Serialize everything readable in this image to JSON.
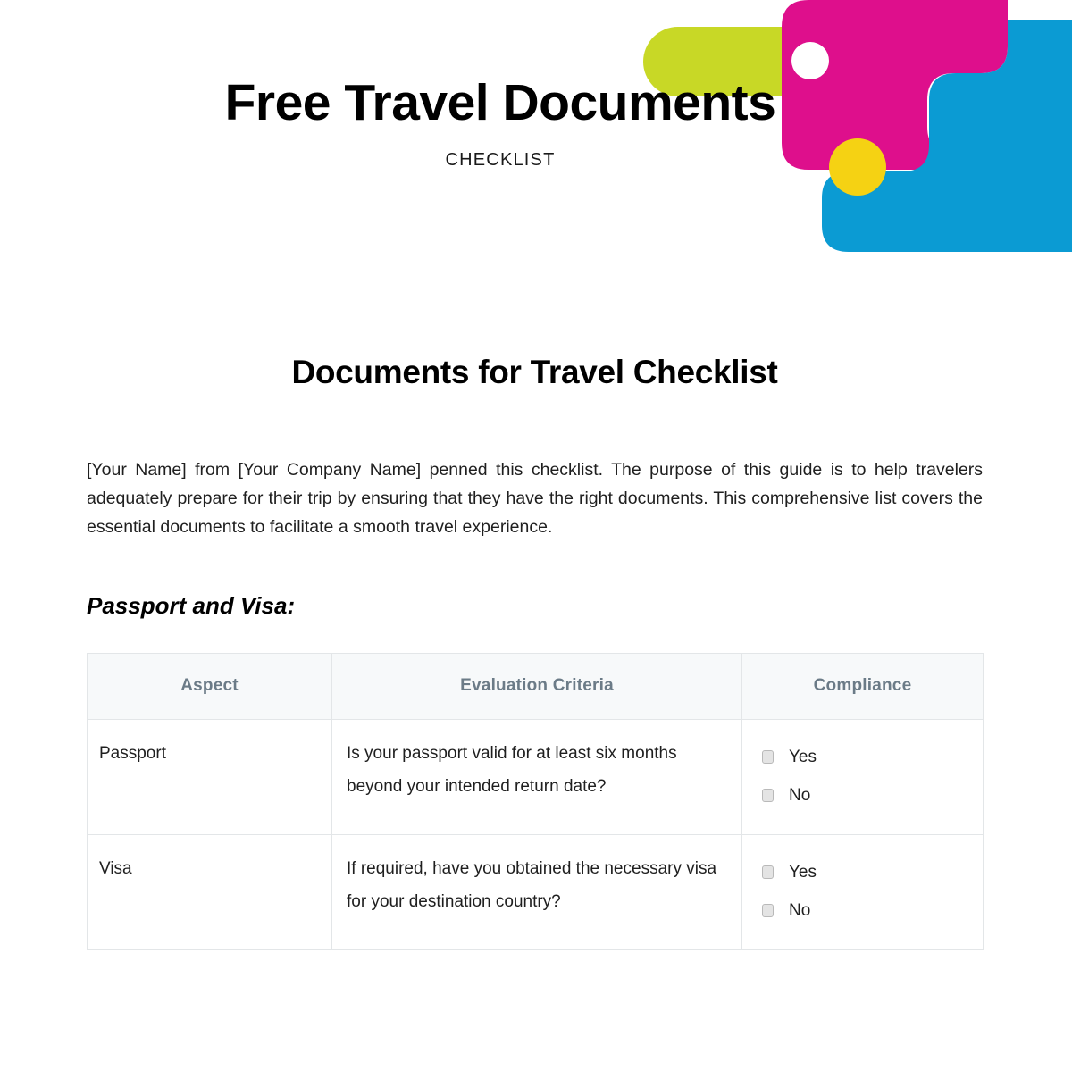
{
  "header": {
    "title": "Free Travel Documents",
    "subtitle": "CHECKLIST"
  },
  "decor": {
    "lime": "#c8d826",
    "magenta": "#de0f8c",
    "cyan": "#0b9bd3",
    "yellow": "#f5d213",
    "white": "#ffffff"
  },
  "main": {
    "section_title": "Documents for Travel Checklist",
    "intro": "[Your Name] from [Your Company Name] penned this checklist. The purpose of this guide is to help travelers adequately prepare for their trip by ensuring that they have the right documents. This comprehensive list covers the essential documents to facilitate a smooth travel experience.",
    "subsection_title": "Passport and Visa:"
  },
  "table": {
    "columns": [
      "Aspect",
      "Evaluation Criteria",
      "Compliance"
    ],
    "rows": [
      {
        "aspect": "Passport",
        "criteria": "Is your passport valid for at least six months beyond your intended return date?",
        "options": [
          "Yes",
          "No"
        ]
      },
      {
        "aspect": "Visa",
        "criteria": "If required, have you obtained the necessary visa for your destination country?",
        "options": [
          "Yes",
          "No"
        ]
      }
    ]
  }
}
